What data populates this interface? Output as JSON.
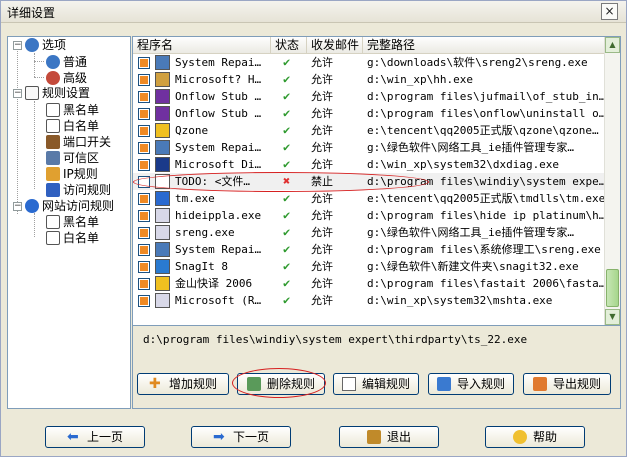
{
  "window": {
    "title": "详细设置",
    "close_label": "×"
  },
  "tree": [
    {
      "label": "选项",
      "icon": "gear-icon",
      "color": "#3b76c4"
    },
    {
      "label": "普通",
      "icon": "gear-icon",
      "color": "#3b76c4"
    },
    {
      "label": "高级",
      "icon": "gear-icon",
      "color": "#c44a3b"
    },
    {
      "label": "规则设置",
      "icon": "rules-icon",
      "color": "#6a6a6a"
    },
    {
      "label": "黑名单",
      "icon": "document-icon",
      "color": "#ffffff"
    },
    {
      "label": "白名单",
      "icon": "document-icon",
      "color": "#ffffff"
    },
    {
      "label": "端口开关",
      "icon": "port-icon",
      "color": "#8a5a2a"
    },
    {
      "label": "可信区",
      "icon": "trusted-icon",
      "color": "#5a7aa8"
    },
    {
      "label": "IP规则",
      "icon": "ip-icon",
      "color": "#e0a030"
    },
    {
      "label": "访问规则",
      "icon": "exe-icon",
      "color": "#3060c0"
    },
    {
      "label": "网站访问规则",
      "icon": "ie-icon",
      "color": "#2a6ad0"
    },
    {
      "label": "黑名单",
      "icon": "document-icon",
      "color": "#ffffff"
    },
    {
      "label": "白名单",
      "icon": "document-icon",
      "color": "#ffffff"
    }
  ],
  "table": {
    "headers": [
      "程序名",
      "状态",
      "收发邮件",
      "完整路径"
    ],
    "rows": [
      {
        "checked": true,
        "name": "System Repai…",
        "status": "ok",
        "mail": "允许",
        "path": "g:\\downloads\\软件\\sreng2\\sreng.exe",
        "icon_color": "#4a7ab8"
      },
      {
        "checked": true,
        "name": "Microsoft? H…",
        "status": "ok",
        "mail": "允许",
        "path": "d:\\win_xp\\hh.exe",
        "icon_color": "#d0a040"
      },
      {
        "checked": true,
        "name": "Onflow Stub …",
        "status": "ok",
        "mail": "允许",
        "path": "d:\\program files\\jufmail\\of_stub_in…",
        "icon_color": "#7030a0"
      },
      {
        "checked": true,
        "name": "Onflow Stub …",
        "status": "ok",
        "mail": "允许",
        "path": "d:\\program files\\onflow\\uninstall o…",
        "icon_color": "#7030a0"
      },
      {
        "checked": true,
        "name": "Qzone",
        "status": "ok",
        "mail": "允许",
        "path": "e:\\tencent\\qq2005正式版\\qzone\\qzone…",
        "icon_color": "#f0c020"
      },
      {
        "checked": true,
        "name": "System Repai…",
        "status": "ok",
        "mail": "允许",
        "path": "g:\\绿色软件\\网络工具_ie插件管理专家…",
        "icon_color": "#4a7ab8"
      },
      {
        "checked": true,
        "name": "Microsoft Di…",
        "status": "ok",
        "mail": "允许",
        "path": "d:\\win_xp\\system32\\dxdiag.exe",
        "icon_color": "#1a3a8a"
      },
      {
        "checked": false,
        "name": "TODO: <文件…",
        "status": "no",
        "mail": "禁止",
        "path": "d:\\program files\\windiy\\system expe…",
        "icon_color": "#ffffff"
      },
      {
        "checked": true,
        "name": "tm.exe",
        "status": "ok",
        "mail": "允许",
        "path": "e:\\tencent\\qq2005正式版\\tmdlls\\tm.exe",
        "icon_color": "#2a6ad0"
      },
      {
        "checked": true,
        "name": "hideippla.exe",
        "status": "ok",
        "mail": "允许",
        "path": "d:\\program files\\hide ip platinum\\h…",
        "icon_color": "#d8d8e8"
      },
      {
        "checked": true,
        "name": "sreng.exe",
        "status": "ok",
        "mail": "允许",
        "path": "g:\\绿色软件\\网络工具_ie插件管理专家…",
        "icon_color": "#d8d8e8"
      },
      {
        "checked": true,
        "name": "System Repai…",
        "status": "ok",
        "mail": "允许",
        "path": "d:\\program files\\系统修理工\\sreng.exe",
        "icon_color": "#4a7ab8"
      },
      {
        "checked": true,
        "name": "SnagIt 8",
        "status": "ok",
        "mail": "允许",
        "path": "g:\\绿色软件\\新建文件夹\\snagit32.exe",
        "icon_color": "#2a7ad0"
      },
      {
        "checked": true,
        "name": "金山快译 2006",
        "status": "ok",
        "mail": "允许",
        "path": "d:\\program files\\fastait 2006\\fasta…",
        "icon_color": "#f0c020"
      },
      {
        "checked": true,
        "name": "Microsoft (R…",
        "status": "ok",
        "mail": "允许",
        "path": "d:\\win_xp\\system32\\mshta.exe",
        "icon_color": "#d8d8e8"
      }
    ],
    "status_ok_glyph": "✔",
    "status_no_glyph": "✖"
  },
  "scrollbar": {
    "up": "▲",
    "down": "▼"
  },
  "selected_path": "d:\\program files\\windiy\\system expert\\thirdparty\\ts_22.exe",
  "actions": {
    "add": "增加规则",
    "delete": "删除规则",
    "edit": "编辑规则",
    "import": "导入规则",
    "export": "导出规则"
  },
  "footer": {
    "prev": "上一页",
    "next": "下一页",
    "exit": "退出",
    "help": "帮助"
  }
}
